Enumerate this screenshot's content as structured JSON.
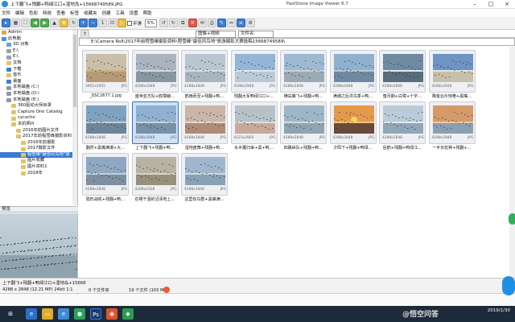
{
  "title": {
    "file_name": "上下翻飞+残翻+鸭绿江口+湿地岛+15668749589.JPG",
    "app_name": "FastStone Image Viewer 6.7"
  },
  "menu": [
    "文件",
    "编辑",
    "色彩",
    "特效",
    "查看",
    "标签",
    "收藏夹",
    "创建",
    "工具",
    "设置",
    "帮助"
  ],
  "toolbar": {
    "checkbox_label": "平滑",
    "zoom_value": "5%",
    "filter_value": "图像+视频",
    "sort_value": "文件名"
  },
  "path": "E:\\Camera Roll\\2017年前程雪峰摄影资料\\程雪峰\"最佳风鸟地\"旅游摄影大赛投稿15668749589\\",
  "tree": {
    "items": [
      {
        "label": "Admin",
        "color": "#d9a942"
      },
      {
        "label": "此电脑",
        "color": "#4f8fd6"
      },
      {
        "label": "3D 对象",
        "color": "#6aa0e0"
      },
      {
        "label": "E:\\",
        "color": "#9aa0a8"
      },
      {
        "label": "E:\\",
        "color": "#9aa0a8"
      },
      {
        "label": "文档",
        "color": "#e0c36a"
      },
      {
        "label": "下载",
        "color": "#3c7fd0"
      },
      {
        "label": "音乐",
        "color": "#e0c36a"
      },
      {
        "label": "桌面",
        "color": "#3c7fd0"
      },
      {
        "label": "本地磁盘 (C:)",
        "color": "#8e9aa8"
      },
      {
        "label": "本地磁盘 (D:)",
        "color": "#8e9aa8"
      },
      {
        "label": "本地磁盘 (E:)",
        "color": "#8e9aa8"
      },
      {
        "label": "360驱动大师目录",
        "color": "#e0c36a"
      },
      {
        "label": "Capture One Catalog",
        "color": "#e0c36a"
      },
      {
        "label": "cycache",
        "color": "#e0c36a"
      },
      {
        "label": "本机照片",
        "color": "#e0c36a"
      },
      {
        "label": "2016年前图片文件",
        "color": "#e0c36a"
      },
      {
        "label": "2017年前程雪峰摄影资料",
        "color": "#e0c36a"
      },
      {
        "label": "2016年前摄影",
        "color": "#e0c36a"
      },
      {
        "label": "2017摄影文件",
        "color": "#e0c36a"
      },
      {
        "label": "程雪峰\"最佳风鸟地\"旅",
        "color": "#e0c36a",
        "selected": true
      },
      {
        "label": "图片收藏",
        "color": "#e0c36a"
      },
      {
        "label": "图片资料1",
        "color": "#e0c36a"
      },
      {
        "label": "2018年",
        "color": "#e0c36a"
      }
    ]
  },
  "preview_label": "预览",
  "thumbnails": [
    {
      "caption": "_DSC2677.1.jpg",
      "dims": "3901x2655",
      "ext": "JPG"
    },
    {
      "caption": "盛世亚方队+鸥鹭翩…",
      "dims": "4288x2848",
      "ext": "JPG"
    },
    {
      "caption": "鹤雨而至+残翻+鸭…",
      "dims": "4288x2848",
      "ext": "JPG"
    },
    {
      "caption": "残翻大军鸭绿江口+…",
      "dims": "4288x2848",
      "ext": "JPG"
    },
    {
      "caption": "横岛翼飞+残翻+鸭…",
      "dims": "4288x2848",
      "ext": "JPG"
    },
    {
      "caption": "满潮之后寻鸟季+鸭…",
      "dims": "4288x2848",
      "ext": "JPG"
    },
    {
      "caption": "蜜月期+白鹭+十字…",
      "dims": "4288x2848",
      "ext": "JPG"
    },
    {
      "caption": "降金云片惊艳+黑嘴…",
      "dims": "4288x2848",
      "ext": "JPG"
    },
    {
      "caption": "翻然+黑嘴满潮+大…",
      "dims": "4288x2848",
      "ext": "JPG"
    },
    {
      "caption": "上下翻飞+残翻+鸭…",
      "dims": "4288x2848",
      "ext": "JPG"
    },
    {
      "caption": "湿地盘舞+残翻+鸭…",
      "dims": "4288x2848",
      "ext": "JPG"
    },
    {
      "caption": "水乡雁归来+黑+鸭…",
      "dims": "4221x2803",
      "ext": "JPG"
    },
    {
      "caption": "四路纵队+残翻+鸭…",
      "dims": "4288x2848",
      "ext": "JPG"
    },
    {
      "caption": "夕阳下+残翻+鸭绿…",
      "dims": "4288x2848",
      "ext": "JPG"
    },
    {
      "caption": "后鹤+残翻+鸭绿江…",
      "dims": "4288x2848",
      "ext": "JPG"
    },
    {
      "caption": "一手长虹种+残翻+…",
      "dims": "4288x2848",
      "ext": "JPG"
    },
    {
      "caption": "隐形战机+残翻+鸭…",
      "dims": "4288x2848",
      "ext": "JPG"
    },
    {
      "caption": "在哪干涸的沼泽地上…",
      "dims": "4288x2428",
      "ext": "JPG"
    },
    {
      "caption": "这里有鸟群+黑嘴满…",
      "dims": "4288x2848",
      "ext": "JPG"
    }
  ],
  "status": {
    "left": "上下翻飞+残翻+鸭绿江口+湿地岛+15668",
    "size_info": "4288 x 2848 (12.21 MP)  24bit 1:1",
    "folder_count": "0 个文件夹",
    "file_count": "19 个文件 (103 MB)"
  },
  "clock": {
    "time": "",
    "date": "2019/1/30"
  }
}
